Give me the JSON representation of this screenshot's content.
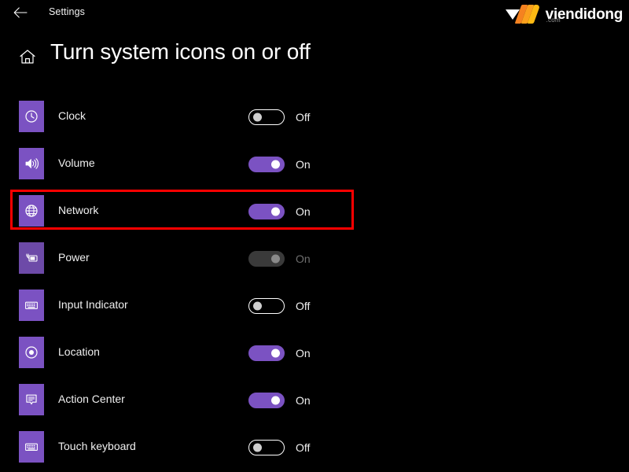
{
  "titlebar": {
    "back_icon": "back-arrow-icon",
    "title": "Settings"
  },
  "watermark": {
    "name": "viendidong",
    "tld": ".com",
    "colors": {
      "triangle": "#ffffff",
      "bar_1": "#f58220",
      "bar_2": "#fba01d",
      "bar_3": "#fdb913"
    }
  },
  "header": {
    "home_icon": "home-icon",
    "title": "Turn system icons on or off"
  },
  "theme": {
    "background": "#000000",
    "accent_purple": "#7b52c2",
    "text": "#f0f0f0",
    "disabled_text": "#6e6e6e",
    "disabled_toggle": "#3a3a3a",
    "highlight_red": "#ff0000"
  },
  "annotation": {
    "highlight_target": "Network",
    "color": "#ff0000"
  },
  "settings": {
    "rows": [
      {
        "label": "Clock",
        "icon": "clock-icon",
        "state": "Off",
        "toggle": "off",
        "enabled": true
      },
      {
        "label": "Volume",
        "icon": "volume-icon",
        "state": "On",
        "toggle": "on",
        "enabled": true
      },
      {
        "label": "Network",
        "icon": "network-globe-icon",
        "state": "On",
        "toggle": "on",
        "enabled": true
      },
      {
        "label": "Power",
        "icon": "power-battery-icon",
        "state": "On",
        "toggle": "disabled",
        "enabled": false
      },
      {
        "label": "Input Indicator",
        "icon": "keyboard-icon",
        "state": "Off",
        "toggle": "off",
        "enabled": true
      },
      {
        "label": "Location",
        "icon": "location-target-icon",
        "state": "On",
        "toggle": "on",
        "enabled": true
      },
      {
        "label": "Action Center",
        "icon": "notification-icon",
        "state": "On",
        "toggle": "on",
        "enabled": true
      },
      {
        "label": "Touch keyboard",
        "icon": "keyboard-icon",
        "state": "Off",
        "toggle": "off",
        "enabled": true
      }
    ]
  }
}
